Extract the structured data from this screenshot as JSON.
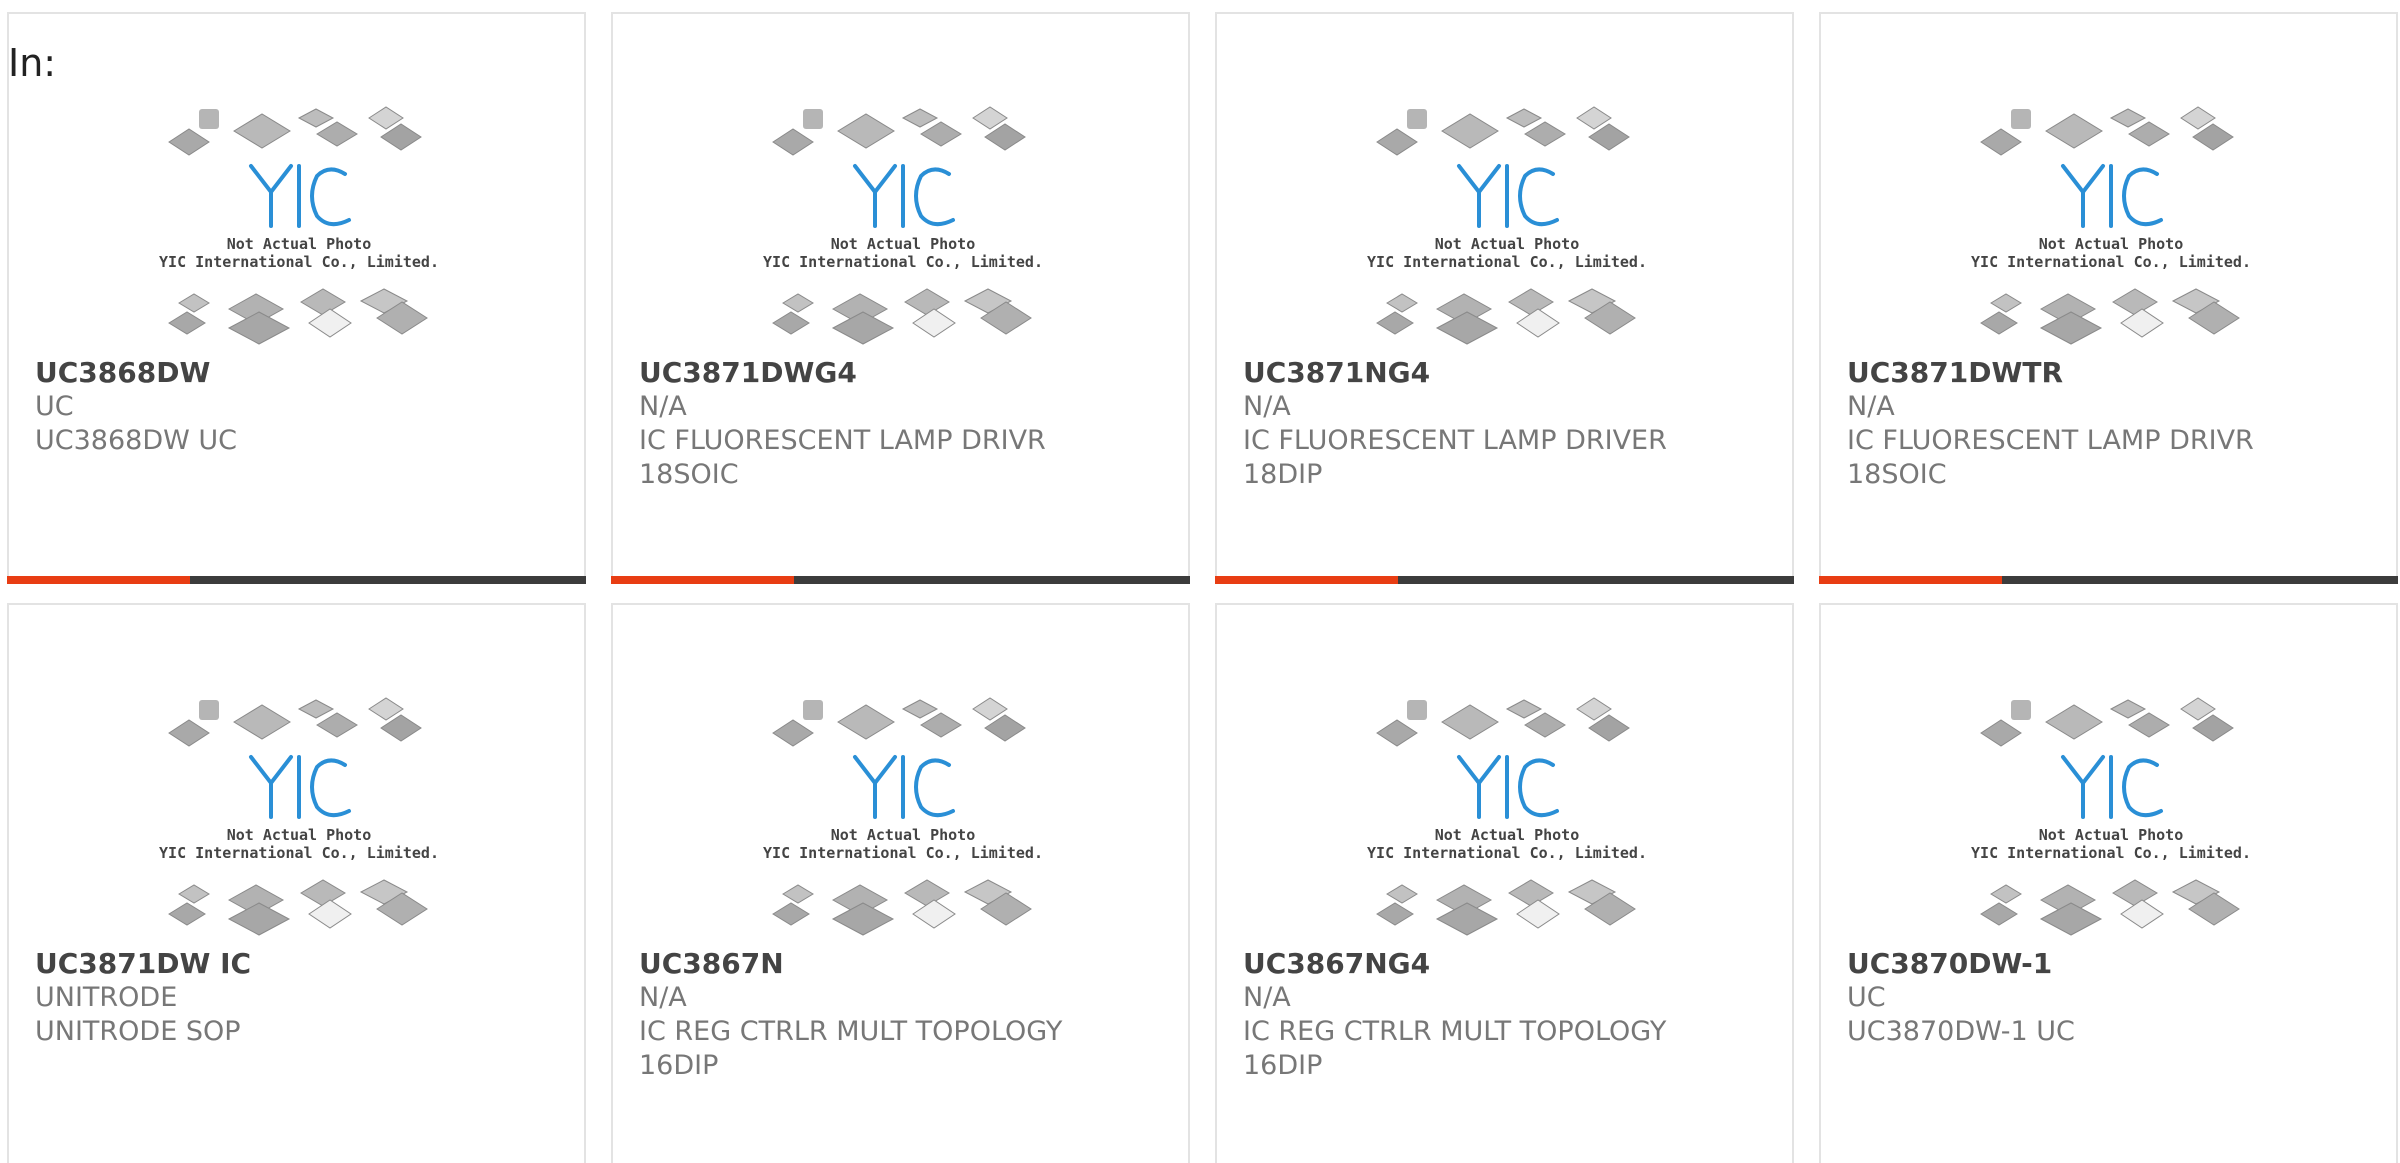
{
  "page_label": "In:",
  "photo_caption": {
    "line1": "Not Actual Photo",
    "line2": "YIC International Co., Limited."
  },
  "colors": {
    "accent": "#e83d13",
    "bar": "#3c3c3c",
    "logo_blue": "#2a8fd6"
  },
  "products": [
    {
      "part": "UC3868DW",
      "brand": "UC",
      "desc1": "UC3868DW UC",
      "desc2": ""
    },
    {
      "part": "UC3871DWG4",
      "brand": "N/A",
      "desc1": "IC FLUORESCENT LAMP DRIVR",
      "desc2": "18SOIC"
    },
    {
      "part": "UC3871NG4",
      "brand": "N/A",
      "desc1": "IC FLUORESCENT LAMP DRIVER",
      "desc2": "18DIP"
    },
    {
      "part": "UC3871DWTR",
      "brand": "N/A",
      "desc1": "IC FLUORESCENT LAMP DRIVR",
      "desc2": "18SOIC"
    },
    {
      "part": "UC3871DW IC",
      "brand": "UNITRODE",
      "desc1": "UNITRODE SOP",
      "desc2": ""
    },
    {
      "part": "UC3867N",
      "brand": "N/A",
      "desc1": "IC REG CTRLR MULT TOPOLOGY",
      "desc2": "16DIP"
    },
    {
      "part": "UC3867NG4",
      "brand": "N/A",
      "desc1": "IC REG CTRLR MULT TOPOLOGY",
      "desc2": "16DIP"
    },
    {
      "part": "UC3870DW-1",
      "brand": "UC",
      "desc1": "UC3870DW-1 UC",
      "desc2": ""
    }
  ]
}
